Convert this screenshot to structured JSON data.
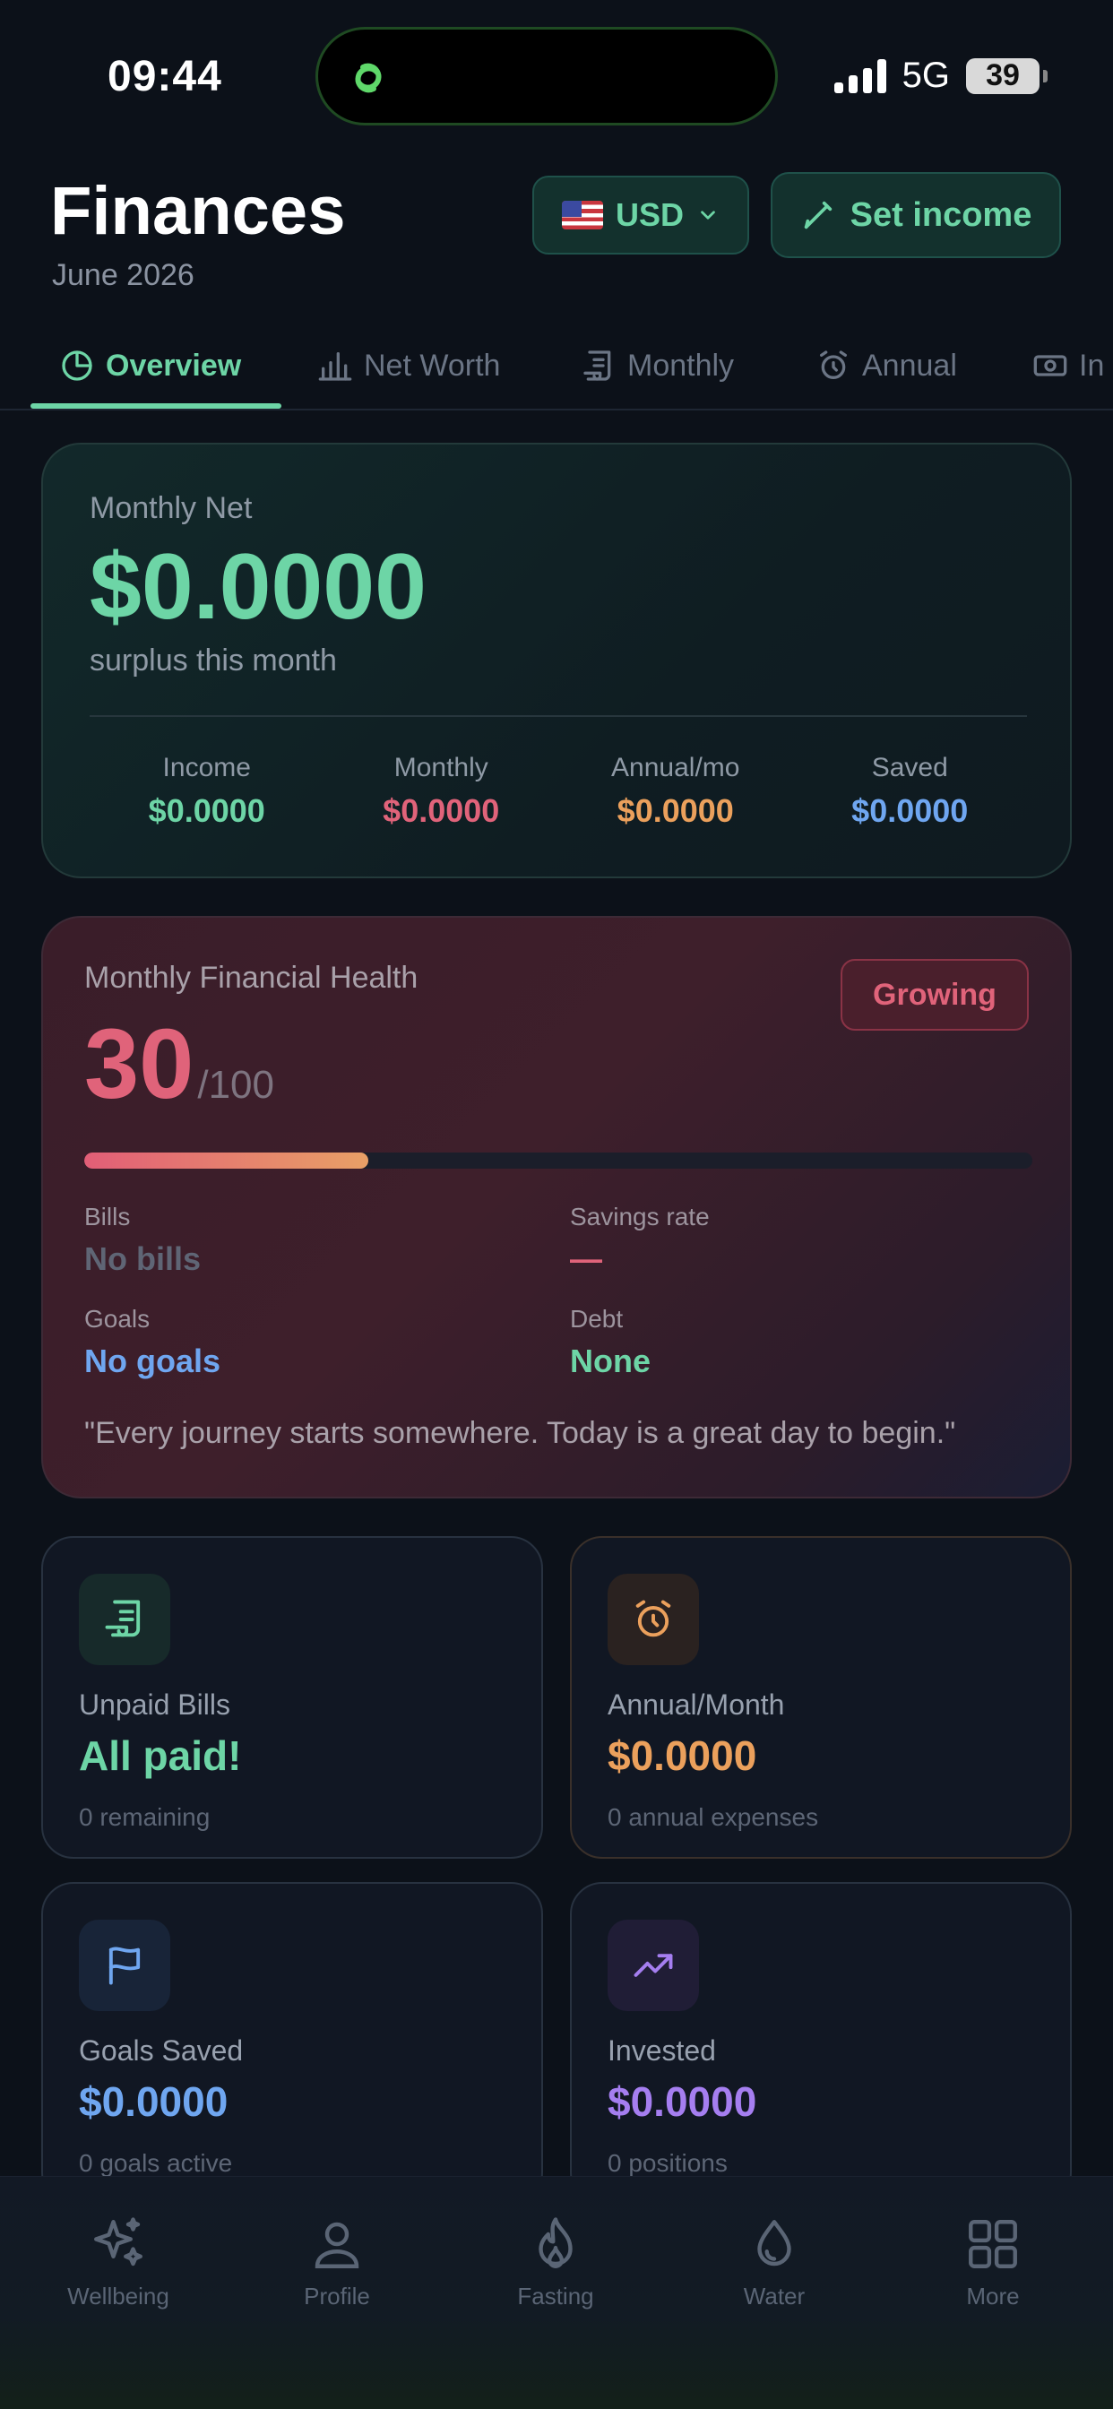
{
  "status_bar": {
    "time": "09:44",
    "network": "5G",
    "battery": "39"
  },
  "header": {
    "title": "Finances",
    "subtitle": "June 2026"
  },
  "currency": {
    "label": "USD"
  },
  "set_income": {
    "label": "Set income"
  },
  "tabs": [
    {
      "label": "Overview",
      "icon": "pie-chart-icon",
      "active": true
    },
    {
      "label": "Net Worth",
      "icon": "bar-chart-icon"
    },
    {
      "label": "Monthly",
      "icon": "receipt-icon"
    },
    {
      "label": "Annual",
      "icon": "alarm-clock-icon"
    },
    {
      "label": "In",
      "icon": "banknote-icon"
    }
  ],
  "net_card": {
    "label": "Monthly Net",
    "value": "$0.0000",
    "subtitle": "surplus this month",
    "stats": [
      {
        "label": "Income",
        "value": "$0.0000",
        "color": "#6dd5a6"
      },
      {
        "label": "Monthly",
        "value": "$0.0000",
        "color": "#e0637a"
      },
      {
        "label": "Annual/mo",
        "value": "$0.0000",
        "color": "#eba05c"
      },
      {
        "label": "Saved",
        "value": "$0.0000",
        "color": "#6fa6f0"
      }
    ]
  },
  "health": {
    "title": "Monthly Financial Health",
    "badge": "Growing",
    "score": "30",
    "max": "/100",
    "progress": 0.3,
    "metrics": {
      "bills": {
        "label": "Bills",
        "value": "No bills",
        "color": "#5f6575"
      },
      "savings_rate": {
        "label": "Savings rate",
        "value": "—",
        "color": "#e0637a"
      },
      "goals": {
        "label": "Goals",
        "value": "No goals",
        "color": "#6fa6f0"
      },
      "debt": {
        "label": "Debt",
        "value": "None",
        "color": "#6dd5a6"
      }
    },
    "quote": "\"Every journey starts somewhere. Today is a great day to begin.\""
  },
  "cards": {
    "unpaid_bills": {
      "label": "Unpaid Bills",
      "value": "All paid!",
      "sub": "0 remaining",
      "color": "#6dd5a6",
      "icon": "receipt-icon"
    },
    "annual_month": {
      "label": "Annual/Month",
      "value": "$0.0000",
      "sub": "0 annual expenses",
      "color": "#eba05c",
      "icon": "alarm-clock-icon"
    },
    "goals_saved": {
      "label": "Goals Saved",
      "value": "$0.0000",
      "sub": "0 goals active",
      "color": "#6fa6f0",
      "icon": "flag-icon"
    },
    "invested": {
      "label": "Invested",
      "value": "$0.0000",
      "sub": "0 positions",
      "color": "#a57ef0",
      "icon": "trending-up-icon"
    }
  },
  "bottom_nav": [
    {
      "label": "Wellbeing",
      "icon": "sparkles-icon"
    },
    {
      "label": "Profile",
      "icon": "user-icon"
    },
    {
      "label": "Fasting",
      "icon": "flame-icon"
    },
    {
      "label": "Water",
      "icon": "droplet-icon"
    },
    {
      "label": "More",
      "icon": "grid-icon"
    }
  ]
}
